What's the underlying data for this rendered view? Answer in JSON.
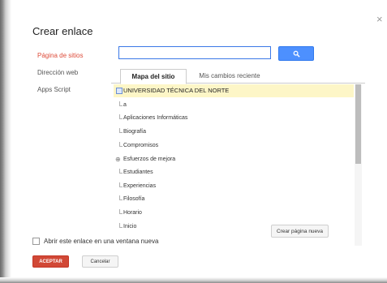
{
  "dialog": {
    "title": "Crear enlace",
    "close_glyph": "×"
  },
  "options": [
    {
      "label": "Página de sitios",
      "active": true
    },
    {
      "label": "Dirección web",
      "active": false
    },
    {
      "label": "Apps Script",
      "active": false
    }
  ],
  "search": {
    "value": "",
    "placeholder": "",
    "button_icon": "search-icon"
  },
  "tabs": [
    {
      "label": "Mapa del sitio",
      "active": true
    },
    {
      "label": "Mis cambios reciente",
      "active": false
    }
  ],
  "tree": [
    {
      "label": "UNIVERSIDAD TÉCNICA DEL NORTE",
      "selected": true,
      "marker": "page-box"
    },
    {
      "label": "a",
      "selected": false,
      "marker": "guide"
    },
    {
      "label": "Aplicaciones Informáticas",
      "selected": false,
      "marker": "guide"
    },
    {
      "label": "Biografía",
      "selected": false,
      "marker": "guide"
    },
    {
      "label": "Compromisos",
      "selected": false,
      "marker": "guide"
    },
    {
      "label": "Esfuerzos de mejora",
      "selected": false,
      "marker": "expand"
    },
    {
      "label": "Estudiantes",
      "selected": false,
      "marker": "guide"
    },
    {
      "label": "Experiencias",
      "selected": false,
      "marker": "guide"
    },
    {
      "label": "Filosofía",
      "selected": false,
      "marker": "guide"
    },
    {
      "label": "Horario",
      "selected": false,
      "marker": "guide"
    },
    {
      "label": "Inicio",
      "selected": false,
      "marker": "guide"
    }
  ],
  "expand_glyph": "⊕",
  "new_page_button": "Crear página nueva",
  "new_window": {
    "label": "Abrir este enlace en una ventana nueva",
    "checked": false
  },
  "buttons": {
    "accept": "ACEPTAR",
    "cancel": "Cancelar"
  },
  "colors": {
    "accent_red": "#dd4b39",
    "primary_blue": "#4d90fe",
    "selected_row": "#fdf6c7",
    "accept_bg": "#d14836"
  }
}
